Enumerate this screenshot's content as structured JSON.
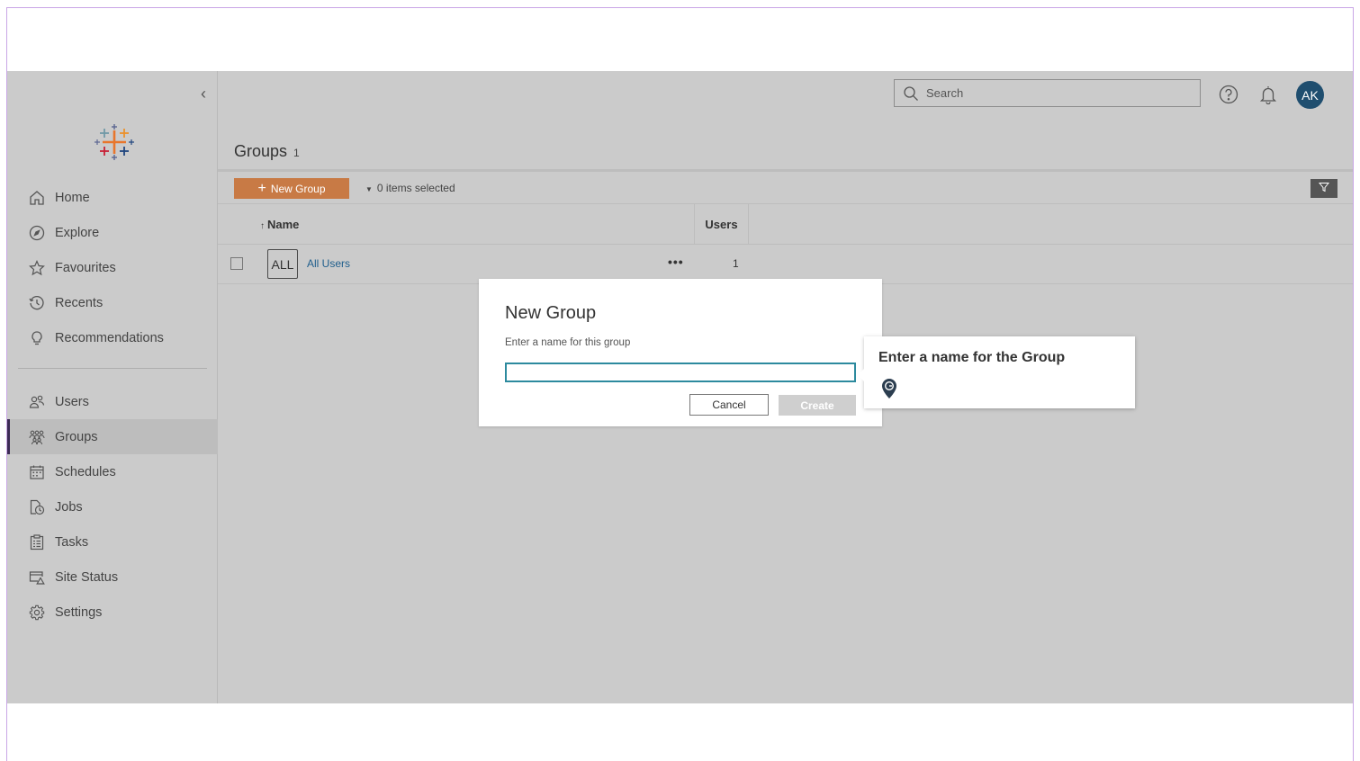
{
  "sidebar": {
    "collapse_glyph": "‹",
    "logo_icon": "tableau-logo-icon",
    "items": [
      {
        "label": "Home",
        "icon": "home-icon",
        "active": false
      },
      {
        "label": "Explore",
        "icon": "compass-icon",
        "active": false
      },
      {
        "label": "Favourites",
        "icon": "star-icon",
        "active": false
      },
      {
        "label": "Recents",
        "icon": "clock-icon",
        "active": false
      },
      {
        "label": "Recommendations",
        "icon": "lightbulb-icon",
        "active": false
      },
      {
        "label": "Users",
        "icon": "users-icon",
        "active": false
      },
      {
        "label": "Groups",
        "icon": "groups-icon",
        "active": true
      },
      {
        "label": "Schedules",
        "icon": "calendar-icon",
        "active": false
      },
      {
        "label": "Jobs",
        "icon": "jobs-icon",
        "active": false
      },
      {
        "label": "Tasks",
        "icon": "clipboard-icon",
        "active": false
      },
      {
        "label": "Site Status",
        "icon": "site-status-icon",
        "active": false
      },
      {
        "label": "Settings",
        "icon": "gear-icon",
        "active": false
      }
    ]
  },
  "header": {
    "search_placeholder": "Search",
    "avatar_initials": "AK"
  },
  "page": {
    "title": "Groups",
    "count": "1"
  },
  "toolbar": {
    "new_group_label": "New Group",
    "selected_text": "0 items selected"
  },
  "table": {
    "columns": [
      "Name",
      "Users"
    ],
    "rows": [
      {
        "badge": "ALL",
        "name": "All Users",
        "more": "•••",
        "users": "1"
      }
    ]
  },
  "modal": {
    "title": "New Group",
    "label": "Enter a name for this group",
    "input_value": "",
    "cancel_label": "Cancel",
    "create_label": "Create"
  },
  "tooltip": {
    "text": "Enter a name for the Group",
    "icon": "guide-pin-icon"
  },
  "colors": {
    "accent_orange": "#c87a45",
    "avatar_blue": "#1f4e6f",
    "link_blue": "#1f5e8c",
    "focus_teal": "#2d8a9e",
    "active_bar": "#3d2b56"
  }
}
